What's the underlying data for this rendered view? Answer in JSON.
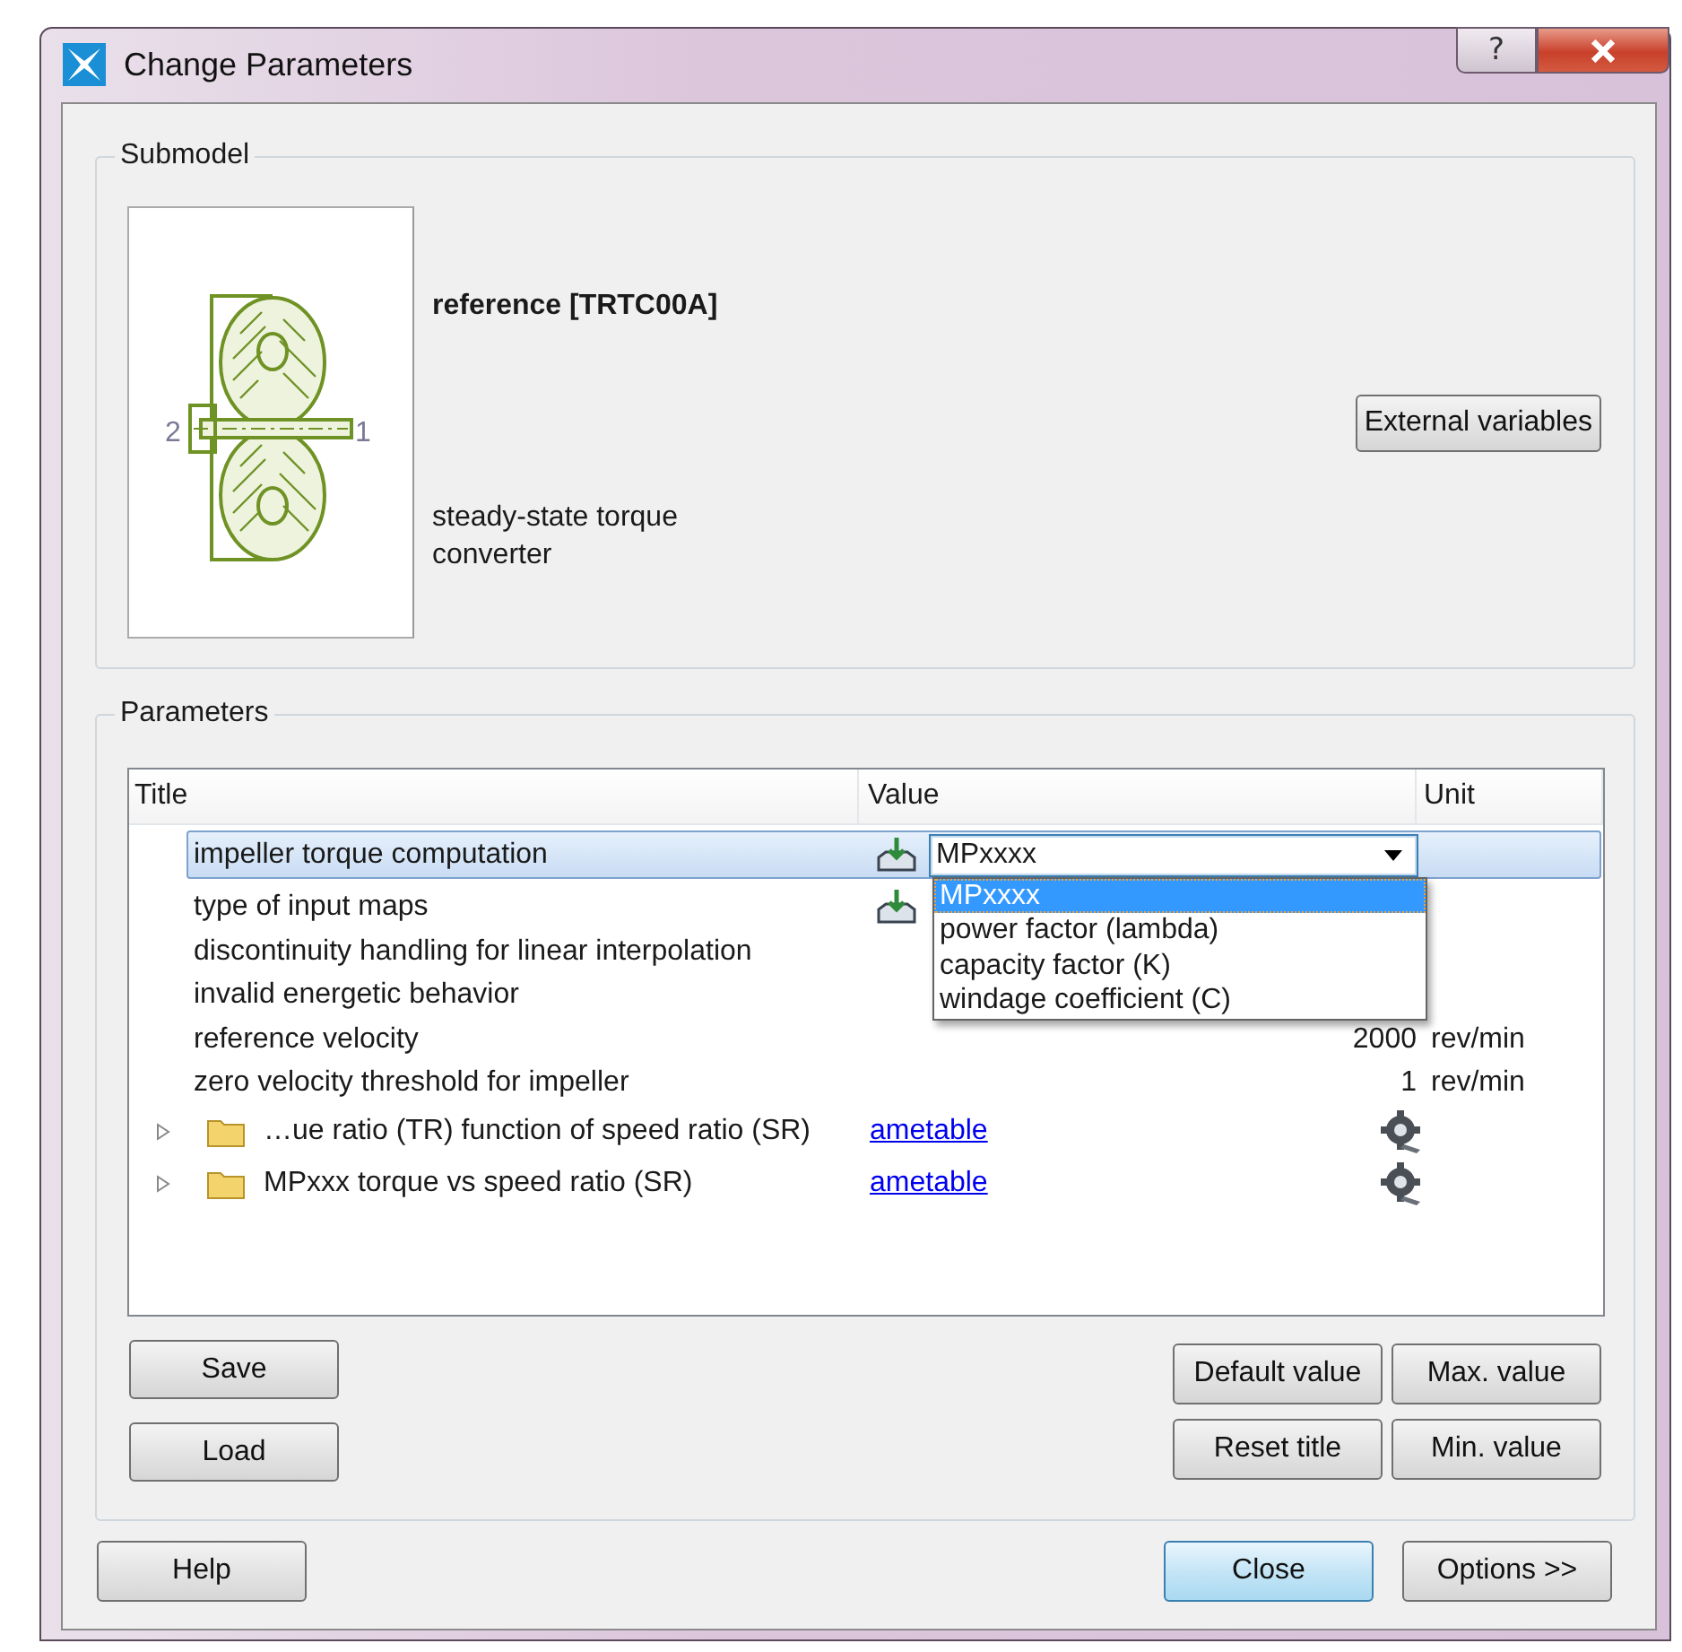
{
  "window": {
    "title": "Change Parameters",
    "help_glyph": "?"
  },
  "submodel": {
    "legend": "Submodel",
    "name": "reference [TRTC00A]",
    "description": "steady-state torque converter",
    "ports": [
      "2",
      "1"
    ],
    "external_button": "External variables"
  },
  "parameters": {
    "legend": "Parameters",
    "columns": [
      "Title",
      "Value",
      "Unit"
    ],
    "rows": [
      {
        "kind": "choice",
        "title": "impeller torque computation",
        "selected": true,
        "value": "MPxxxx",
        "open": true,
        "options": [
          {
            "label": "MPxxxx",
            "selected": true
          },
          {
            "label": "power factor (lambda)",
            "selected": false
          },
          {
            "label": "capacity factor (K)",
            "selected": false
          },
          {
            "label": "windage coefficient (C)",
            "selected": false
          }
        ]
      },
      {
        "kind": "choice",
        "title": "type of input maps",
        "selected": false
      },
      {
        "kind": "plain",
        "title": "discontinuity handling for linear interpolation",
        "selected": false
      },
      {
        "kind": "plain",
        "title": "invalid energetic behavior",
        "selected": false
      },
      {
        "kind": "number",
        "title": "reference velocity",
        "selected": false,
        "value": "2000",
        "unit": "rev/min"
      },
      {
        "kind": "number",
        "title": "zero velocity threshold for impeller",
        "selected": false,
        "value": "1",
        "unit": "rev/min"
      },
      {
        "kind": "table",
        "title": "…ue ratio (TR) function of speed ratio (SR)",
        "selected": false,
        "expanded": false,
        "value": "ametable"
      },
      {
        "kind": "table",
        "title": "MPxxx torque vs speed ratio (SR)",
        "selected": false,
        "expanded": false,
        "value": "ametable"
      }
    ],
    "side_buttons": [
      "Save",
      "Load"
    ],
    "value_buttons": [
      "Default value",
      "Max. value",
      "Reset title",
      "Min. value"
    ]
  },
  "footer": {
    "buttons": [
      {
        "label": "Help",
        "default": false
      },
      {
        "label": "Close",
        "default": true
      },
      {
        "label": "Options >>",
        "default": false
      }
    ]
  }
}
